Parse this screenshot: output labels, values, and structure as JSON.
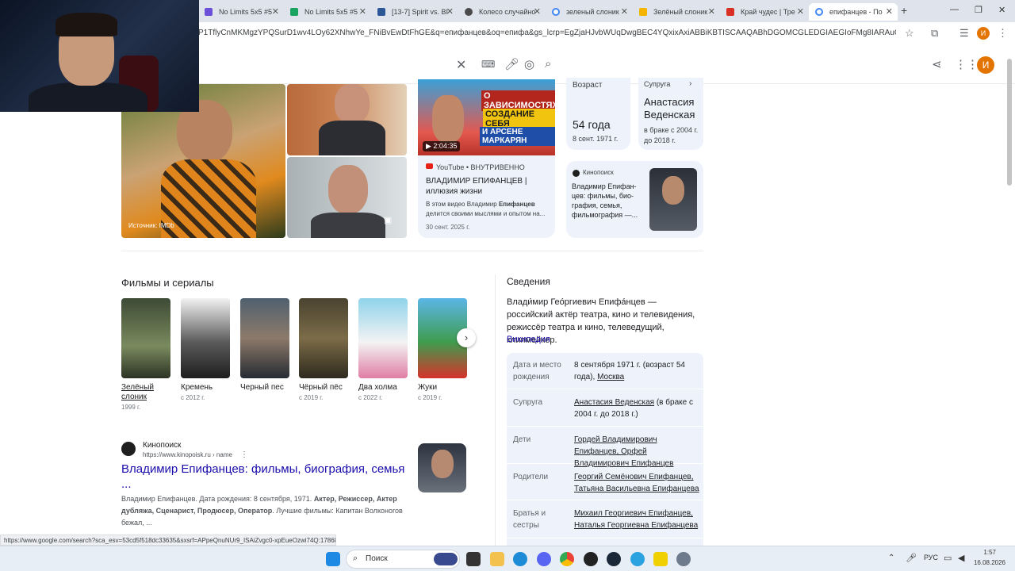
{
  "browser": {
    "tabs": [
      {
        "label": "No Limits 5x5 #5",
        "color": "#6b4fd8"
      },
      {
        "label": "No Limits 5x5 #5",
        "color": "#1aa260"
      },
      {
        "label": "[13-7] Spirit vs. BI",
        "color": "#2b5797"
      },
      {
        "label": "Колесо случайно",
        "color": "#4a4a4a"
      },
      {
        "label": "зеленый слоник",
        "color": "#4285f4"
      },
      {
        "label": "Зелёный слоник",
        "color": "#f4b400"
      },
      {
        "label": "Край чудес | Тре",
        "color": "#d93025"
      },
      {
        "label": "епифанцев - По",
        "color": "#4285f4"
      }
    ],
    "url": "P1TflyCnMKMgzYPQSurD1wv4LOy62XNhwYe_FNiBvEwDtFhGE&q=епифанцев&oq=епифа&gs_lcrp=EgZjaHJvbWUqDwgBEC4YQxixAxiABBiKBTISCAAQABhDGOMCGLEDGIAEGIoFMg8IARAuGEMYsQMYgAQYigUyD..."
  },
  "user_initial": "И",
  "hero": {
    "source_label": "Источник: IMDb",
    "video": {
      "duration": "2:04:35",
      "poster_line1": "О ЗАВИСИМОСТЯХ",
      "poster_line2": "СОЗДАНИЕ СЕБЯ",
      "poster_line3": "И АРСЕНЕ МАРКАРЯН",
      "source": "YouTube • ВНУТРИВЕННО",
      "title": "ВЛАДИМИР ЕПИФАНЦЕВ | иллюзия жизни",
      "snippet_plain": "В этом видео Владимир ",
      "snippet_bold": "Епифанцев",
      "snippet_rest": " делится своими мыслями и опытом на...",
      "date": "30 сент. 2025 г."
    },
    "age": {
      "label": "Возраст",
      "value": "54 года",
      "date": "8 сент. 1971 г."
    },
    "spouse": {
      "label": "Супруга",
      "name": "Анастасия Веденская",
      "detail": "в браке с 2004 г. до 2018 г."
    },
    "kinopoisk": {
      "source": "Кинопоиск",
      "text": "Владимир Епифан-цев: фильмы, био-графия, семья, фильмография —..."
    }
  },
  "films": {
    "title": "Фильмы и сериалы",
    "items": [
      {
        "title": "Зелёный слоник",
        "year": "1999 г.",
        "color": "#5b6a4a"
      },
      {
        "title": "Кремень",
        "year": "с 2012 г.",
        "color": "#3a3a3a"
      },
      {
        "title": "Черный пес",
        "year": "",
        "color": "#4a5566"
      },
      {
        "title": "Чёрный пёс",
        "year": "с 2019 г.",
        "color": "#6b6040"
      },
      {
        "title": "Два холма",
        "year": "с 2022 г.",
        "color": "#7ec8e3"
      },
      {
        "title": "Жуки",
        "year": "с 2019 г.",
        "color": "#3f8c4a"
      }
    ]
  },
  "result": {
    "site": "Кинопоиск",
    "url": "https://www.kinopoisk.ru › name",
    "title": "Владимир Епифанцев: фильмы, биография, семья ...",
    "snippet_a": "Владимир Епифанцев. Дата рождения: 8 сентября, 1971. ",
    "snippet_bold": "Актер, Режиссер, Актер дубляжа, Сценарист, Продюсер, Оператор",
    "snippet_b": ". Лучшие фильмы: Капитан Волконогов бежал, ..."
  },
  "info": {
    "title": "Сведения",
    "description": "Влади́мир Гео́ргиевич Епифа́нцев — российский актёр театра, кино и телевидения, режиссёр театра и кино, телеведущий, клипмейкер.",
    "wiki": "Википедия",
    "rows": [
      {
        "label": "Дата и место рождения",
        "value": "8 сентября 1971 г. (возраст 54 года), ",
        "link": "Москва"
      },
      {
        "label": "Супруга",
        "value": "",
        "link": "Анастасия Веденская",
        "tail": " (в браке с 2004 г. до 2018 г.)"
      },
      {
        "label": "Дети",
        "value": "",
        "link": "Гордей Владимирович Епифанцев, Орфей Владимирович Епифанцев"
      },
      {
        "label": "Родители",
        "value": "",
        "link": "Георгий Семёнович Епифанцев, Татьяна Васильевна Епифанцева"
      },
      {
        "label": "Братья и сестры",
        "value": "",
        "link": "Михаил Георгиевич Епифанцев, Наталья Георгиевна Епифанцева"
      }
    ]
  },
  "status_url": "https://www.google.com/search?sca_esv=53cd5f518dc33635&sxsrf=APpeQnuNUr9_ISAiZvgc0-xpEueOzwi74Q:17868...",
  "taskbar": {
    "search": "Поиск",
    "lang": "РУС",
    "time": "1:57",
    "date": "16.08.2026"
  }
}
